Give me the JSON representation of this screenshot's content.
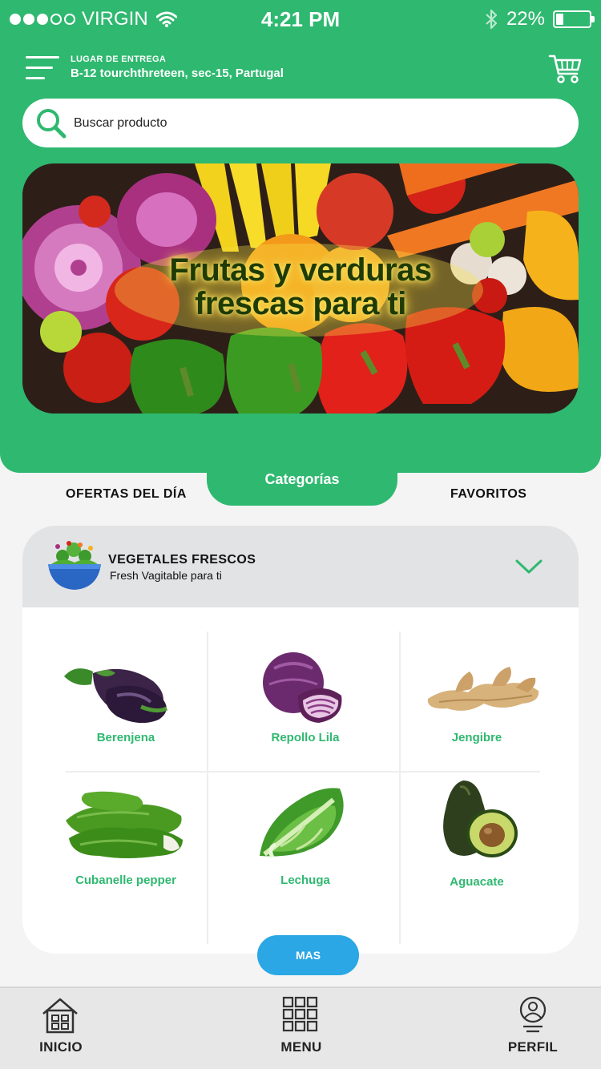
{
  "status_bar": {
    "carrier": "VIRGIN",
    "time": "4:21 PM",
    "battery": "22%",
    "battery_level": 0.22,
    "signal_dots_filled": 3,
    "signal_dots_total": 5
  },
  "header": {
    "delivery_label": "LUGAR DE ENTREGA",
    "delivery_address": "B-12 tourchthreteen, sec-15, Partugal",
    "menu_icon": "hamburger-menu-icon",
    "cart_icon": "cart-icon"
  },
  "search": {
    "placeholder": "Buscar producto",
    "icon": "search-icon"
  },
  "banner": {
    "line1": "Frutas y verduras",
    "line2": "frescas para ti"
  },
  "tabs": {
    "left": "OFERTAS DEL DÍA",
    "active": "Categorías",
    "right": "FAVORITOS"
  },
  "category": {
    "title": "VEGETALES FRESCOS",
    "subtitle": "Fresh Vagitable para ti",
    "icon": "salad-bowl-icon",
    "items": [
      {
        "label": "Berenjena",
        "icon": "eggplant-icon"
      },
      {
        "label": "Repollo Lila",
        "icon": "red-cabbage-icon"
      },
      {
        "label": "Jengibre",
        "icon": "ginger-icon"
      },
      {
        "label": "Cubanelle pepper",
        "icon": "green-pepper-icon"
      },
      {
        "label": "Lechuga",
        "icon": "lettuce-icon"
      },
      {
        "label": "Aguacate",
        "icon": "avocado-icon"
      }
    ]
  },
  "more_button": "MAS",
  "bottom_nav": {
    "home": "INICIO",
    "menu": "MENU",
    "profile": "PERFIL"
  },
  "colors": {
    "brand_green": "#2fb870",
    "button_blue": "#2aa7e4",
    "header_gray": "#e2e3e5"
  }
}
